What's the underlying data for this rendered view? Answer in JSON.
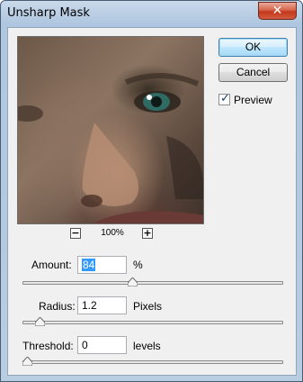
{
  "window": {
    "title": "Unsharp Mask",
    "close_glyph": "✕"
  },
  "buttons": {
    "ok_label": "OK",
    "cancel_label": "Cancel"
  },
  "preview_option": {
    "label": "Preview",
    "checked": true
  },
  "zoom": {
    "minus_glyph": "−",
    "plus_glyph": "+",
    "value": "100%"
  },
  "amount": {
    "label": "Amount:",
    "value": "84",
    "unit": "%",
    "slider_fraction": 0.42
  },
  "radius": {
    "label": "Radius:",
    "value": "1.2",
    "unit": "Pixels",
    "slider_fraction": 0.05
  },
  "threshold": {
    "label": "Threshold:",
    "value": "0",
    "unit": "levels",
    "slider_fraction": 0.0
  },
  "colors": {
    "accent": "#3399ff",
    "title_bar": "#b9cde2",
    "close_button": "#c2381c"
  }
}
